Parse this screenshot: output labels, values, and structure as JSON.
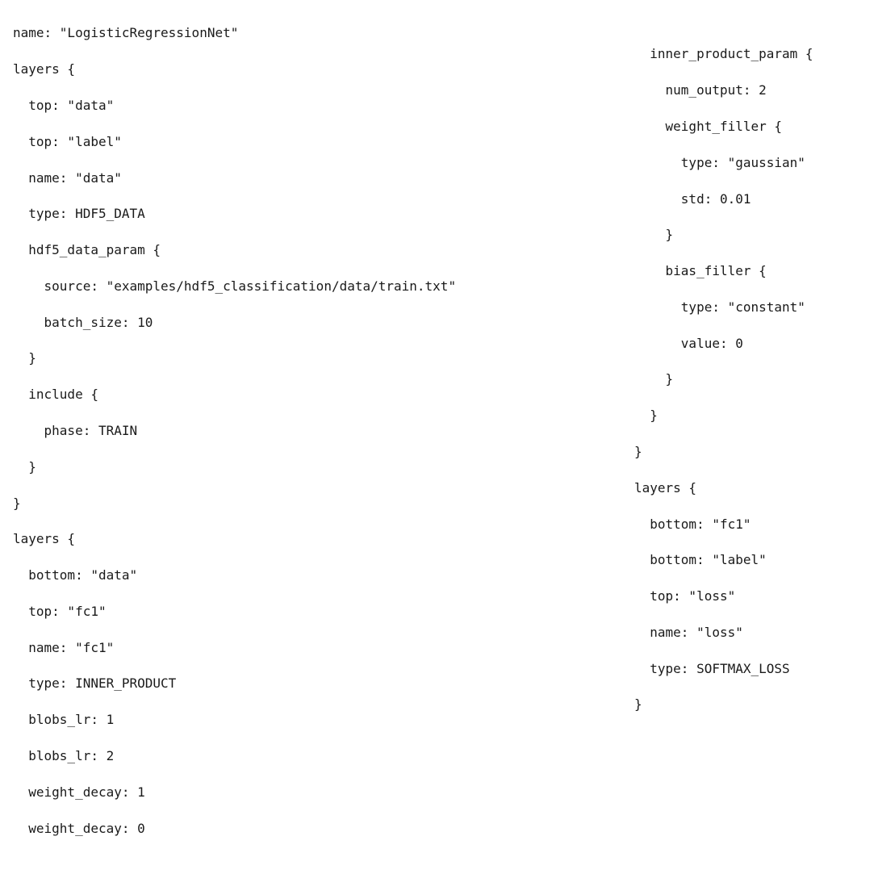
{
  "left": {
    "l1": "name: \"LogisticRegressionNet\"",
    "l2": "layers {",
    "l3": "  top: \"data\"",
    "l4": "  top: \"label\"",
    "l5": "  name: \"data\"",
    "l6": "  type: HDF5_DATA",
    "l7": "  hdf5_data_param {",
    "l8": "    source: \"examples/hdf5_classification/data/train.txt\"",
    "l9": "    batch_size: 10",
    "l10": "  }",
    "l11": "  include {",
    "l12": "    phase: TRAIN",
    "l13": "  }",
    "l14": "}",
    "l15": "layers {",
    "l16": "  bottom: \"data\"",
    "l17": "  top: \"fc1\"",
    "l18": "  name: \"fc1\"",
    "l19": "  type: INNER_PRODUCT",
    "l20": "  blobs_lr: 1",
    "l21": "  blobs_lr: 2",
    "l22": "  weight_decay: 1",
    "l23": "  weight_decay: 0"
  },
  "right": {
    "r1": "  inner_product_param {",
    "r2": "    num_output: 2",
    "r3": "    weight_filler {",
    "r4": "      type: \"gaussian\"",
    "r5": "      std: 0.01",
    "r6": "    }",
    "r7": "    bias_filler {",
    "r8": "      type: \"constant\"",
    "r9": "      value: 0",
    "r10": "    }",
    "r11": "  }",
    "r12": "}",
    "r13": "layers {",
    "r14": "  bottom: \"fc1\"",
    "r15": "  bottom: \"label\"",
    "r16": "  top: \"loss\"",
    "r17": "  name: \"loss\"",
    "r18": "  type: SOFTMAX_LOSS",
    "r19": "}"
  }
}
